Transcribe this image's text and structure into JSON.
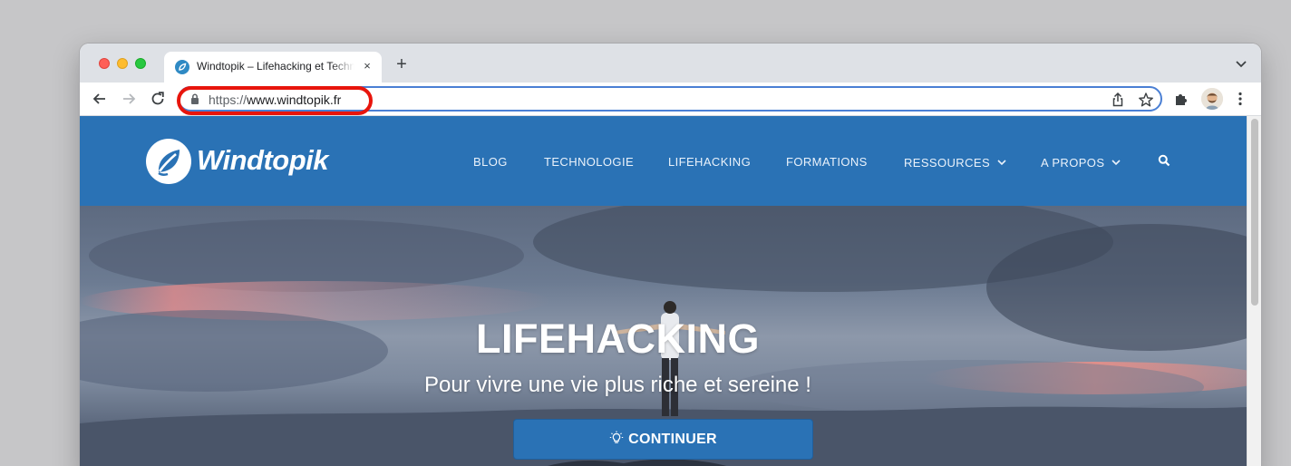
{
  "browser": {
    "tab": {
      "title": "Windtopik – Lifehacking et Technologie",
      "close_glyph": "×"
    },
    "new_tab_glyph": "+",
    "address": {
      "scheme": "https://",
      "host": "www.windtopik.fr"
    },
    "colors": {
      "highlight": "#e8150c",
      "omnibox_focus": "#4a7fd4"
    }
  },
  "site": {
    "logo_text": "Windtopik",
    "nav": [
      {
        "label": "BLOG"
      },
      {
        "label": "TECHNOLOGIE"
      },
      {
        "label": "LIFEHACKING"
      },
      {
        "label": "FORMATIONS"
      },
      {
        "label": "RESSOURCES",
        "has_dropdown": true
      },
      {
        "label": "A PROPOS",
        "has_dropdown": true
      }
    ],
    "hero": {
      "title": "LIFEHACKING",
      "subtitle": "Pour vivre une vie plus riche et sereine !",
      "cta_label": "CONTINUER"
    },
    "colors": {
      "brand": "#2a72b5"
    }
  }
}
